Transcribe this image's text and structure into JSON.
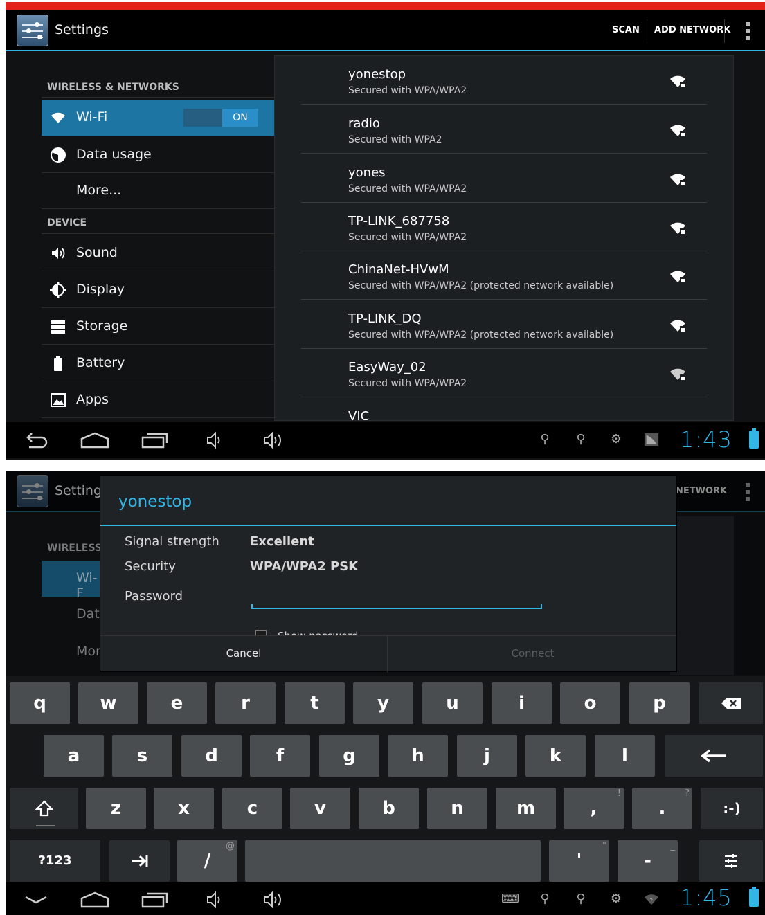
{
  "screen1": {
    "actionbar": {
      "title": "Settings",
      "scan": "SCAN",
      "add_network": "ADD NETWORK"
    },
    "sections": {
      "wireless": "WIRELESS & NETWORKS",
      "device": "DEVICE"
    },
    "menu": {
      "wifi": "Wi-Fi",
      "wifi_state": "ON",
      "data_usage": "Data usage",
      "more": "More...",
      "sound": "Sound",
      "display": "Display",
      "storage": "Storage",
      "battery": "Battery",
      "apps": "Apps"
    },
    "networks": [
      {
        "name": "yonestop",
        "security": "Secured with WPA/WPA2"
      },
      {
        "name": "radio",
        "security": "Secured with WPA2"
      },
      {
        "name": "yones",
        "security": "Secured with WPA/WPA2"
      },
      {
        "name": "TP-LINK_687758",
        "security": "Secured with WPA/WPA2"
      },
      {
        "name": "ChinaNet-HVwM",
        "security": "Secured with WPA/WPA2 (protected network available)"
      },
      {
        "name": "TP-LINK_DQ",
        "security": "Secured with WPA/WPA2 (protected network available)"
      },
      {
        "name": "EasyWay_02",
        "security": "Secured with WPA/WPA2"
      },
      {
        "name": "VIC",
        "security": ""
      }
    ],
    "clock": "1:43"
  },
  "screen2": {
    "bg": {
      "title": "Settings",
      "add_network": "NETWORK",
      "wireless": "WIRELESS",
      "wifi": "Wi-F",
      "data": "Data",
      "more": "Mor"
    },
    "dialog": {
      "title": "yonestop",
      "signal_label": "Signal strength",
      "signal_value": "Excellent",
      "security_label": "Security",
      "security_value": "WPA/WPA2 PSK",
      "password_label": "Password",
      "show_password": "Show password",
      "cancel": "Cancel",
      "connect": "Connect"
    },
    "keyboard": {
      "row1": [
        "q",
        "w",
        "e",
        "r",
        "t",
        "y",
        "u",
        "i",
        "o",
        "p"
      ],
      "row2": [
        "a",
        "s",
        "d",
        "f",
        "g",
        "h",
        "j",
        "k",
        "l"
      ],
      "row3": [
        "z",
        "x",
        "c",
        "v",
        "b",
        "n",
        "m",
        ",",
        "."
      ],
      "row3_hints": [
        "",
        "",
        "",
        "",
        "",
        "",
        "",
        "!",
        "?"
      ],
      "symbols": "?123",
      "slash": "/",
      "slash_hint": "@",
      "apostrophe": "'",
      "apostrophe_hint": "\"",
      "dash": "-",
      "dash_hint": "_",
      "smiley": ":-)"
    },
    "clock": "1:45"
  },
  "colors": {
    "accent": "#33b5e5",
    "highlight": "#1d75a4",
    "banner": "#e2231a"
  }
}
